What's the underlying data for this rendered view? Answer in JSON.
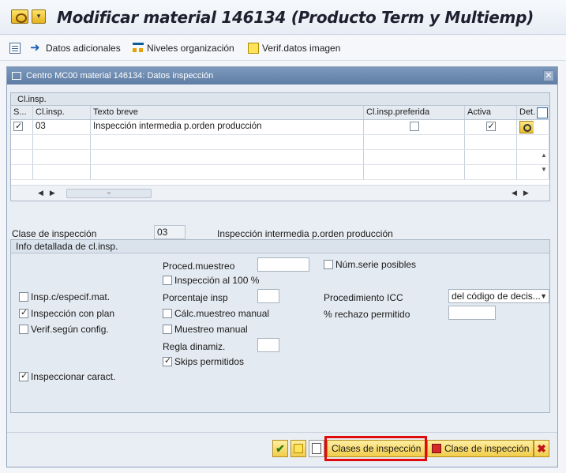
{
  "window": {
    "title": "Modificar material 146134 (Producto Term y Multiemp)",
    "title_icon": "sap-session-icon",
    "title_dropdown_icon": "dropdown-icon"
  },
  "toolbar": {
    "items": [
      {
        "icon": "document-icon",
        "label": ""
      },
      {
        "icon": "arrow-right-icon",
        "label": "Datos adicionales"
      },
      {
        "icon": "org-levels-icon",
        "label": "Niveles organización"
      },
      {
        "icon": "verify-icon",
        "label": "Verif.datos imagen"
      }
    ]
  },
  "dialog": {
    "title": "Centro MC00 material 146134: Datos inspección",
    "close_icon": "close-icon",
    "table": {
      "title": "Cl.insp.",
      "columns": [
        "S...",
        "Cl.insp.",
        "Texto breve",
        "Cl.insp.preferida",
        "Activa",
        "Det."
      ],
      "rows": [
        {
          "selected": true,
          "cl_insp": "03",
          "texto": "Inspección intermedia p.orden producción",
          "preferida": false,
          "activa": true
        }
      ]
    },
    "clase": {
      "label": "Clase de inspección",
      "value": "03",
      "description": "Inspección intermedia p.orden producción"
    },
    "info": {
      "title": "Info detallada de cl.insp.",
      "proced_muestreo_label": "Proced.muestreo",
      "proced_muestreo_value": "",
      "num_serie_label": "Núm.serie posibles",
      "insp_100_label": "Inspección al 100 %",
      "porcentaje_label": "Porcentaje insp",
      "porcentaje_value": "",
      "procedimiento_icc_label": "Procedimiento ICC",
      "procedimiento_icc_value": "del código de decis...",
      "calc_muestreo_label": "Cálc.muestreo manual",
      "rechazo_label": "% rechazo permitido",
      "rechazo_value": "",
      "muestreo_manual_label": "Muestreo manual",
      "regla_label": "Regla dinamiz.",
      "regla_value": "",
      "skips_label": "Skips permitidos",
      "insp_especif_label": "Insp.c/especif.mat.",
      "insp_plan_label": "Inspección con plan",
      "verif_config_label": "Verif.según config.",
      "inspeccionar_label": "Inspeccionar caract."
    },
    "checks": {
      "insp_100": false,
      "num_serie": false,
      "calc_muestreo": false,
      "muestreo_manual": false,
      "skips": true,
      "insp_especif": false,
      "insp_plan": true,
      "verif_config": false,
      "inspeccionar": true
    },
    "footer": {
      "clases_btn": "Clases de inspección",
      "clase_btn": "Clase de inspección",
      "icons": [
        "confirm-check-icon",
        "verify-icon",
        "new-document-icon",
        "delete-icon",
        "cancel-icon"
      ]
    }
  },
  "colors": {
    "dialog_header": "#6f8db3",
    "highlight_box": "#e00b0b",
    "button_yellow": "#f1cd4a"
  }
}
